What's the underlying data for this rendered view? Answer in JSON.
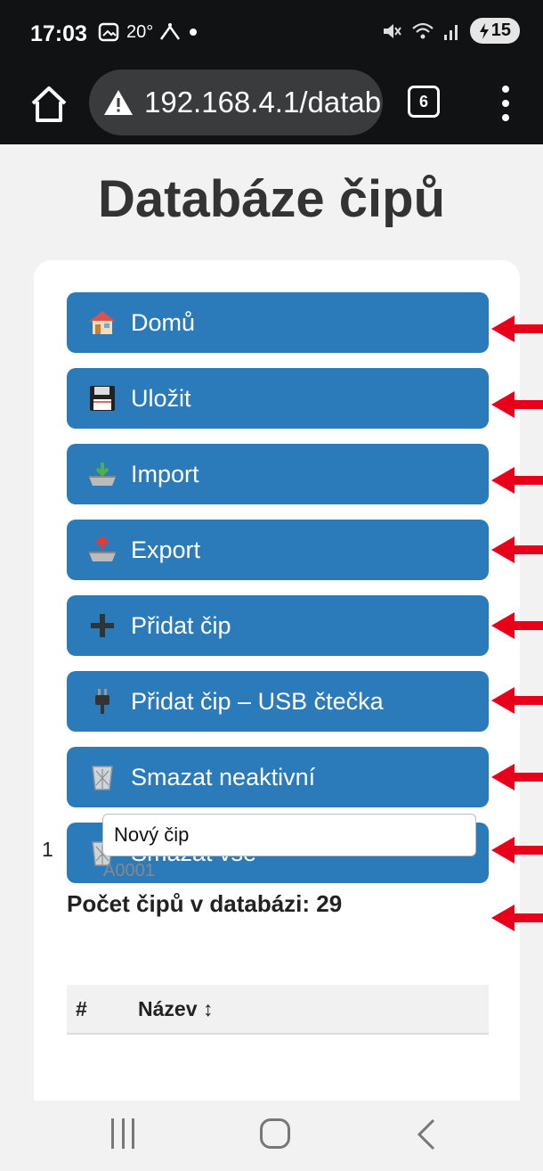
{
  "status_bar": {
    "time": "17:03",
    "left_icons": [
      "gallery-icon",
      "temperature-icon",
      "weather-icon",
      "dot-icon"
    ],
    "temperature_label": "20°",
    "battery": "15"
  },
  "browser": {
    "url": "192.168.4.1/datab",
    "tab_count": "6"
  },
  "page": {
    "title": "Databáze čipů"
  },
  "buttons": [
    {
      "label": "Domů",
      "icon": "house-icon"
    },
    {
      "label": "Uložit",
      "icon": "floppy-disk-icon"
    },
    {
      "label": "Import",
      "icon": "inbox-tray-icon"
    },
    {
      "label": "Export",
      "icon": "outbox-tray-icon"
    },
    {
      "label": "Přidat čip",
      "icon": "plus-icon"
    },
    {
      "label": "Přidat čip – USB čtečka",
      "icon": "electric-plug-icon"
    },
    {
      "label": "Smazat neaktivní",
      "icon": "wastebasket-icon"
    },
    {
      "label": "Smazat vše",
      "icon": "wastebasket-icon"
    }
  ],
  "count_text": "Počet čipů v databázi: 29",
  "table": {
    "headers": [
      "#",
      "Název ↕"
    ],
    "rows": [
      {
        "num": "1",
        "name": "Nový čip",
        "id": "A0001"
      }
    ]
  },
  "colors": {
    "button_bg": "#2b7bbb",
    "arrow": "#e8001b",
    "topbar_bg": "#111213"
  }
}
